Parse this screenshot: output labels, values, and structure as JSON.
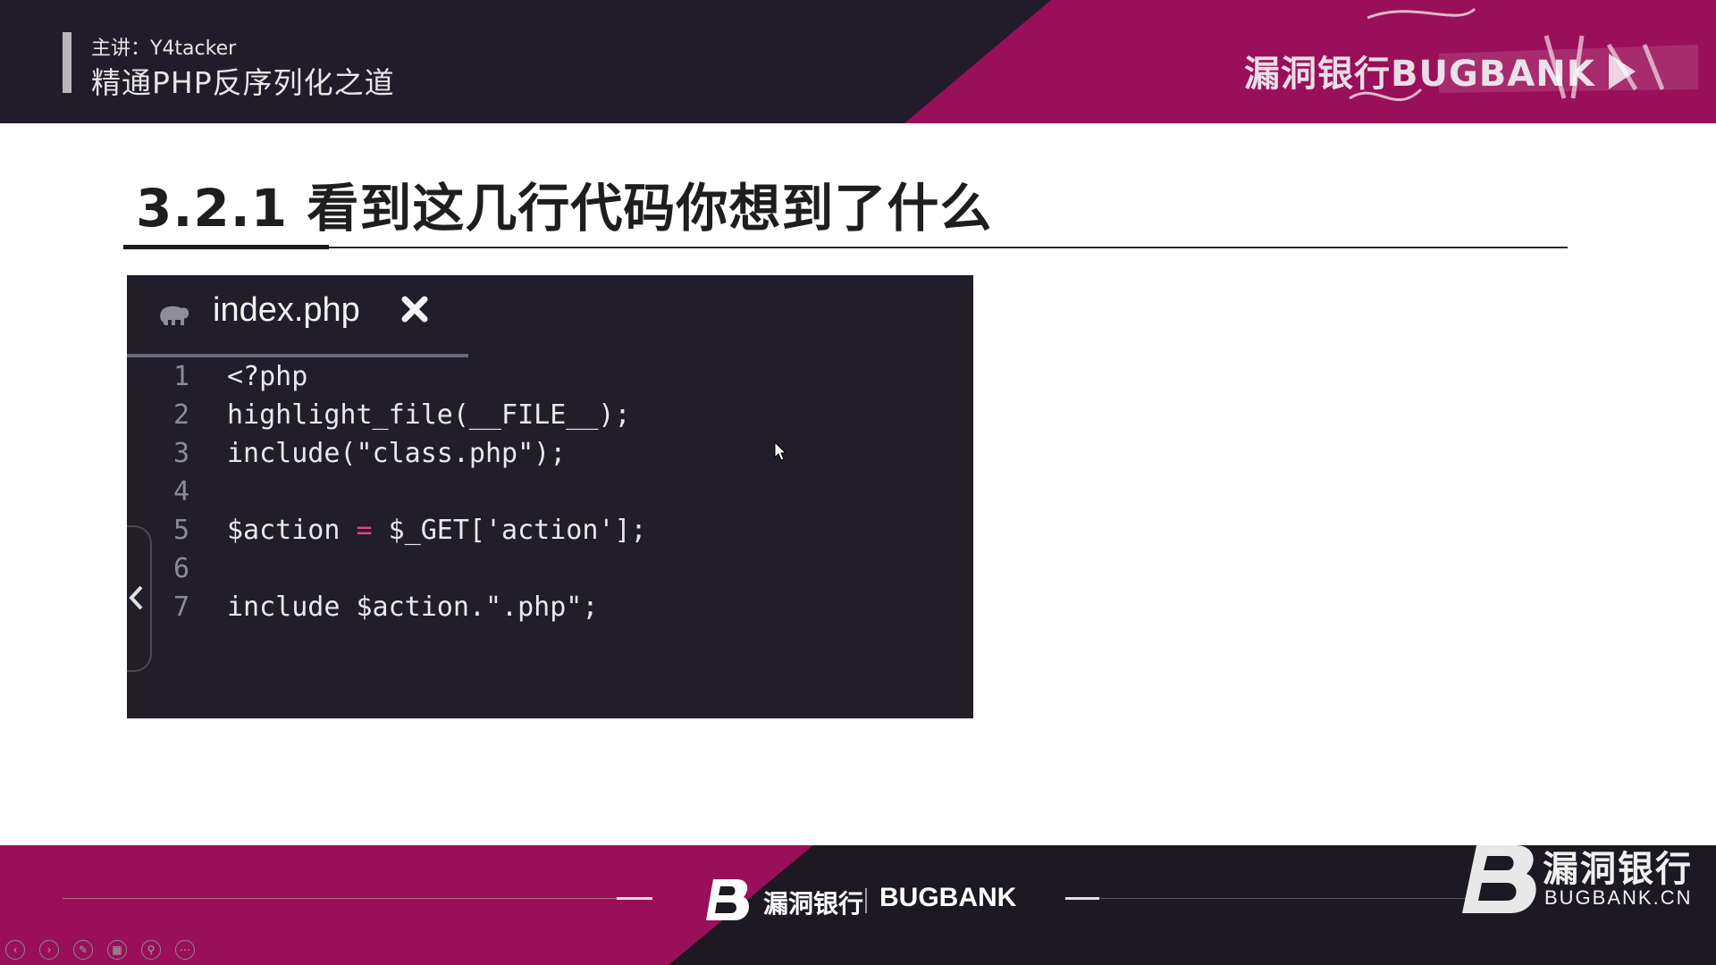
{
  "header": {
    "presenter": "主讲：Y4tacker",
    "course_title": "精通PHP反序列化之道",
    "brand": "漏洞银行BUGBANK",
    "colors": {
      "dark": "#221c2a",
      "accent": "#9a0f5a"
    }
  },
  "slide": {
    "title": "3.2.1 看到这几行代码你想到了什么"
  },
  "editor": {
    "tab_filename": "index.php",
    "tab_icon": "php-elephant-icon",
    "close_icon": "close-icon",
    "lines": [
      {
        "n": "1",
        "code": "<?php"
      },
      {
        "n": "2",
        "code": "highlight_file(__FILE__);"
      },
      {
        "n": "3",
        "code": "include(\"class.php\");"
      },
      {
        "n": "4",
        "code": ""
      },
      {
        "n": "5",
        "pre": "$action ",
        "op": "=",
        "post": " $_GET['action'];"
      },
      {
        "n": "6",
        "code": ""
      },
      {
        "n": "7",
        "code": "include $action.\".php\";"
      }
    ]
  },
  "footer": {
    "brand_cn": "漏洞银行",
    "brand_en": "BUGBANK",
    "corner_cn": "漏洞银行",
    "corner_en": "BUGBANK.CN",
    "toolbar_icons": [
      "previous-icon",
      "next-icon",
      "pen-icon",
      "slides-icon",
      "zoom-icon",
      "more-icon"
    ]
  }
}
